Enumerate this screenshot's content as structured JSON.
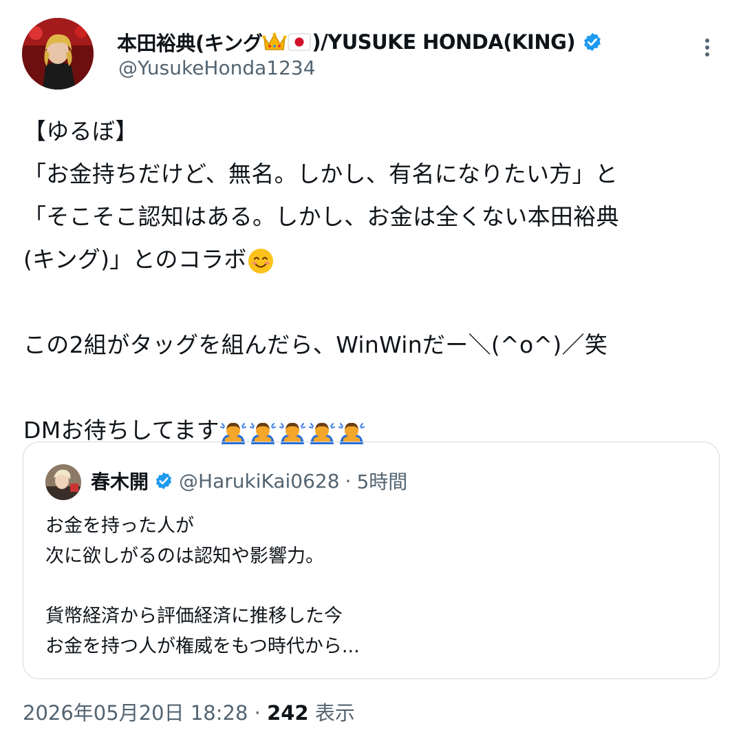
{
  "author": {
    "display_name_prefix": "本田裕典(キング",
    "display_name_suffix": ")/YUSUKE HONDA(KING)",
    "handle": "@YusukeHonda1234",
    "verified_color": "#1d9bf0"
  },
  "icons": [
    "crown-emoji",
    "japan-flag-emoji",
    "verified-badge-icon",
    "more-options-icon",
    "smiling-face-emoji",
    "bowing-person-emoji"
  ],
  "tweet": {
    "line1": "【ゆるぼ】",
    "line2": "「お金持ちだけど、無名。しかし、有名になりたい方」と",
    "line3": "「そこそこ認知はある。しかし、お金は全くない本田裕典",
    "line4": "(キング)」とのコラボ",
    "line5": "この2組がタッグを組んだら、WinWinだー＼(^o^)／笑",
    "line6": "DMお待ちしてます"
  },
  "quoted": {
    "display_name": "春木開",
    "handle": "@HarukiKai0628",
    "separator": "·",
    "time": "5時間",
    "line1": "お金を持った人が",
    "line2": "次に欲しがるのは認知や影響力。",
    "line3": "貨幣経済から評価経済に推移した今",
    "line4": "お金を持つ人が権威をもつ時代から..."
  },
  "meta": {
    "timestamp": "2026年05月20日 18:28",
    "separator": "·",
    "views_count": "242",
    "views_label": "表示"
  }
}
